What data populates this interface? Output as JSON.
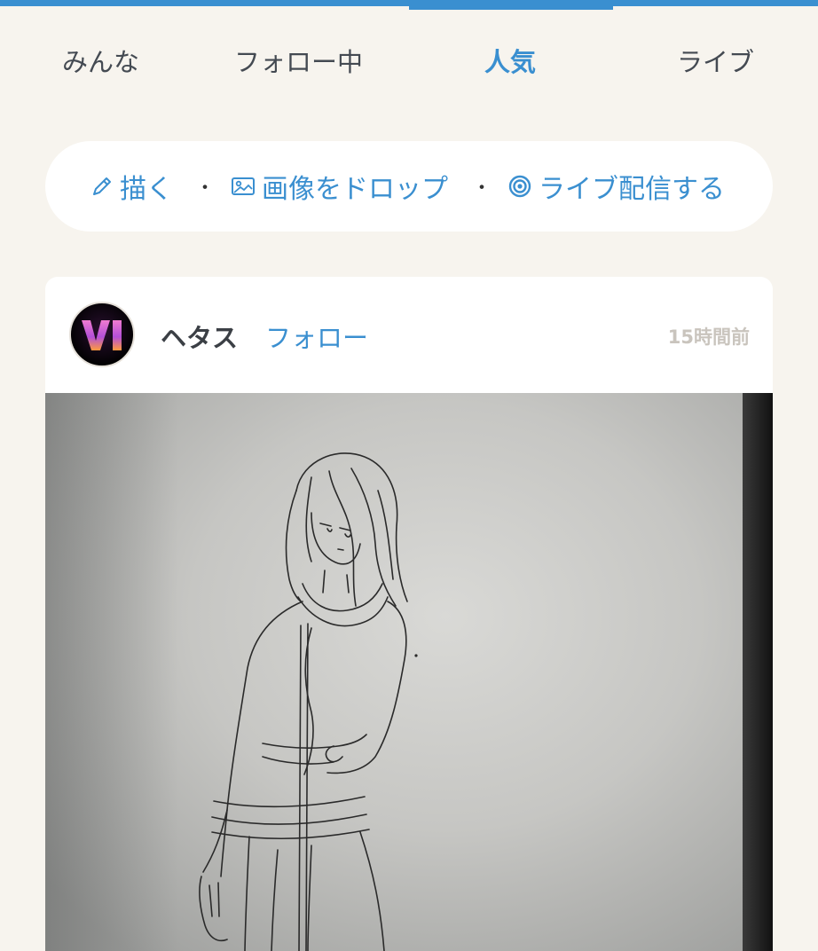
{
  "tabs": [
    {
      "label": "みんな",
      "active": false
    },
    {
      "label": "フォロー中",
      "active": false
    },
    {
      "label": "人気",
      "active": true
    },
    {
      "label": "ライブ",
      "active": false
    }
  ],
  "actions": {
    "draw_label": "描く",
    "drop_label": "画像をドロップ",
    "live_label": "ライブ配信する",
    "separator": "・"
  },
  "post": {
    "username": "ヘタス",
    "follow_label": "フォロー",
    "timestamp": "15時間前",
    "avatar_text": "VI"
  },
  "colors": {
    "accent": "#3a8fd0",
    "background": "#f7f4ee",
    "text": "#444a52",
    "muted": "#c9c4bd"
  },
  "icons": {
    "draw": "pencil-icon",
    "drop": "image-icon",
    "live": "broadcast-icon"
  }
}
